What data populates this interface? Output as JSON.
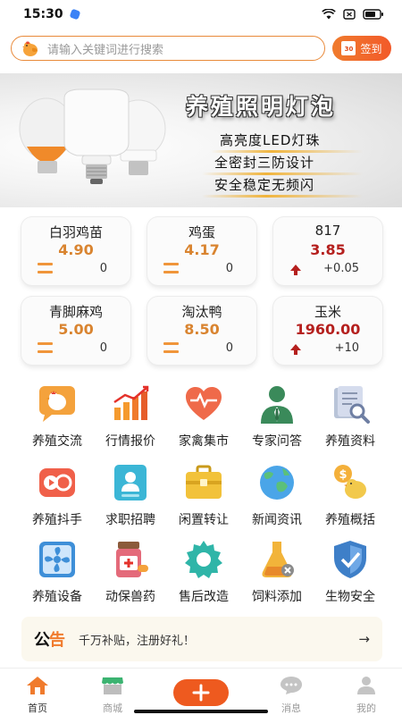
{
  "status_bar": {
    "time": "15:30"
  },
  "search": {
    "placeholder": "请输入关键词进行搜索"
  },
  "signin": {
    "label": "签到",
    "calendar_text": "30"
  },
  "banner": {
    "title": "养殖照明灯泡",
    "features": [
      "高亮度LED灯珠",
      "全密封三防设计",
      "安全稳定无频闪"
    ]
  },
  "prices": [
    {
      "name": "白羽鸡苗",
      "price": "4.90",
      "trend": "flat",
      "change": "0"
    },
    {
      "name": "鸡蛋",
      "price": "4.17",
      "trend": "flat",
      "change": "0"
    },
    {
      "name": "817",
      "price": "3.85",
      "trend": "up",
      "change": "+0.05"
    },
    {
      "name": "青脚麻鸡",
      "price": "5.00",
      "trend": "flat",
      "change": "0"
    },
    {
      "name": "淘汰鸭",
      "price": "8.50",
      "trend": "flat",
      "change": "0"
    },
    {
      "name": "玉米",
      "price": "1960.00",
      "trend": "up",
      "change": "+10"
    }
  ],
  "grid": [
    {
      "label": "养殖交流",
      "icon": "chat-chicken-icon"
    },
    {
      "label": "行情报价",
      "icon": "bar-chart-icon"
    },
    {
      "label": "家禽集市",
      "icon": "heart-market-icon"
    },
    {
      "label": "专家问答",
      "icon": "expert-icon"
    },
    {
      "label": "养殖资料",
      "icon": "document-search-icon"
    },
    {
      "label": "养殖抖手",
      "icon": "video-icon"
    },
    {
      "label": "求职招聘",
      "icon": "id-card-icon"
    },
    {
      "label": "闲置转让",
      "icon": "briefcase-icon"
    },
    {
      "label": "新闻资讯",
      "icon": "globe-icon"
    },
    {
      "label": "养殖概括",
      "icon": "money-chick-icon"
    },
    {
      "label": "养殖设备",
      "icon": "fan-icon"
    },
    {
      "label": "动保兽药",
      "icon": "medicine-icon"
    },
    {
      "label": "售后改造",
      "icon": "gear-icon"
    },
    {
      "label": "饲料添加",
      "icon": "flask-icon"
    },
    {
      "label": "生物安全",
      "icon": "shield-icon"
    }
  ],
  "notice": {
    "badge": "公告",
    "text": "千万补贴，注册好礼！",
    "arrow": "→"
  },
  "tabbar": {
    "items": [
      {
        "label": "首页",
        "icon": "home-icon",
        "active": true
      },
      {
        "label": "商城",
        "icon": "shop-icon",
        "active": false
      },
      {
        "label": "",
        "icon": "plus-icon",
        "active": false
      },
      {
        "label": "消息",
        "icon": "message-icon",
        "active": false
      },
      {
        "label": "我的",
        "icon": "user-icon",
        "active": false
      }
    ]
  },
  "colors": {
    "accent": "#f07b2d",
    "price_flat": "#d98430",
    "price_up": "#b5201e",
    "plus_button": "#ee5a1f"
  }
}
